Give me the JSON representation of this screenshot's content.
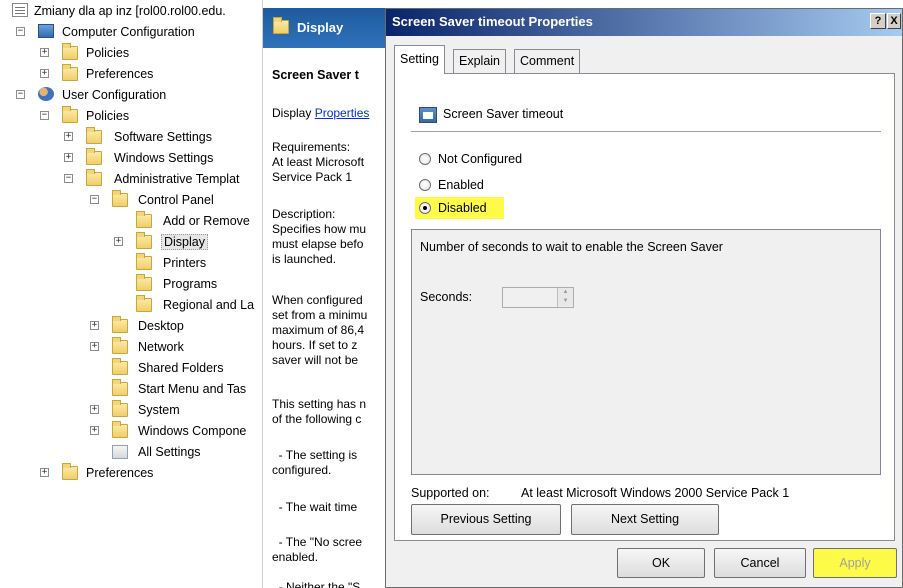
{
  "tree": {
    "items": [
      {
        "label": "Zmiany dla ap inz [rol00.rol00.edu.",
        "icon": "doc-icon"
      },
      {
        "label": "Computer Configuration",
        "icon": "computer-icon"
      },
      {
        "label": "Policies",
        "icon": "folder-icon"
      },
      {
        "label": "Preferences",
        "icon": "folder-icon"
      },
      {
        "label": "User Configuration",
        "icon": "users-icon"
      },
      {
        "label": "Policies",
        "icon": "folder-icon"
      },
      {
        "label": "Software Settings",
        "icon": "folder-icon"
      },
      {
        "label": "Windows Settings",
        "icon": "folder-icon"
      },
      {
        "label": "Administrative Templat",
        "icon": "folder-icon"
      },
      {
        "label": "Control Panel",
        "icon": "folder-icon"
      },
      {
        "label": "Add or Remove",
        "icon": "folder-icon"
      },
      {
        "label": "Display",
        "icon": "folder-icon"
      },
      {
        "label": "Printers",
        "icon": "folder-icon"
      },
      {
        "label": "Programs",
        "icon": "folder-icon"
      },
      {
        "label": "Regional and La",
        "icon": "folder-icon"
      },
      {
        "label": "Desktop",
        "icon": "folder-icon"
      },
      {
        "label": "Network",
        "icon": "folder-icon"
      },
      {
        "label": "Shared Folders",
        "icon": "folder-icon"
      },
      {
        "label": "Start Menu and Tas",
        "icon": "folder-icon"
      },
      {
        "label": "System",
        "icon": "folder-icon"
      },
      {
        "label": "Windows Compone",
        "icon": "folder-icon"
      },
      {
        "label": "All Settings",
        "icon": "all-settings-icon"
      },
      {
        "label": "Preferences",
        "icon": "folder-icon"
      }
    ],
    "toggle_expanded": "−",
    "toggle_collapsed": "+"
  },
  "middle": {
    "header": "Display",
    "setting_title": "Screen Saver t",
    "display_prefix": "Display ",
    "properties_link": "Properties",
    "requirements": "Requirements:\nAt least Microsoft\nService Pack 1",
    "description": "Description:\nSpecifies how mu\nmust elapse befo\nis launched.",
    "when_configured": "When configured\nset from a minimu\nmaximum of 86,4\nhours. If set to z\nsaver will not be",
    "this_setting": "This setting has n\nof the following c",
    "bullet1": "  - The setting is\nconfigured.",
    "bullet2": "  - The wait time",
    "bullet3": "  - The \"No scree\nenabled.",
    "bullet4": "  - Neither the \"S"
  },
  "dialog": {
    "title": "Screen Saver timeout Properties",
    "help_button": "?",
    "close_button": "X",
    "tabs": [
      "Setting",
      "Explain",
      "Comment"
    ],
    "policy_name": "Screen Saver timeout",
    "radio_options": [
      "Not Configured",
      "Enabled",
      "Disabled"
    ],
    "selected_option": "Disabled",
    "options_description": "Number of seconds to wait to enable the Screen Saver",
    "seconds_label": "Seconds:",
    "seconds_value": "",
    "supported_label": "Supported on:",
    "supported_value": "At least Microsoft Windows 2000 Service Pack 1",
    "previous_button": "Previous Setting",
    "next_button": "Next Setting",
    "ok_button": "OK",
    "cancel_button": "Cancel",
    "apply_button": "Apply",
    "highlight_color": "#fdfb47"
  }
}
